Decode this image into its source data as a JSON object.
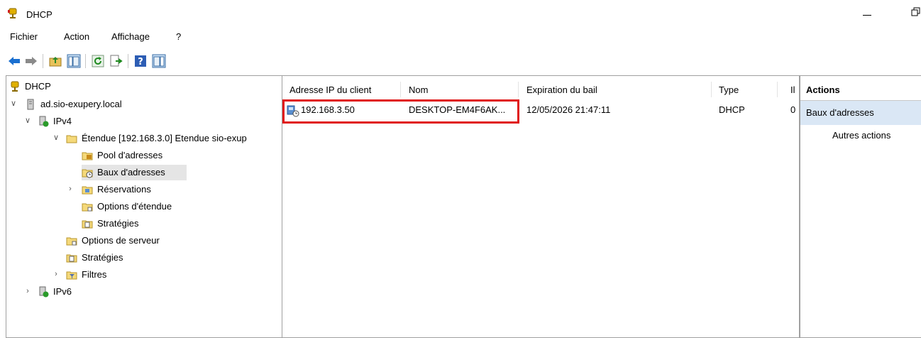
{
  "window": {
    "title": "DHCP"
  },
  "menu": [
    "Fichier",
    "Action",
    "Affichage",
    "?"
  ],
  "toolbar": {
    "buttons": [
      "back-icon",
      "forward-icon",
      "up-folder-icon",
      "show-hide-tree-icon",
      "refresh-icon",
      "export-list-icon",
      "help-icon",
      "show-hide-action-pane-icon"
    ]
  },
  "tree": {
    "root": "DHCP",
    "server": "ad.sio-exupery.local",
    "ipv4": "IPv4",
    "scope": "Étendue [192.168.3.0] Etendue sio-exup",
    "pool": "Pool d'adresses",
    "leases": "Baux d'adresses",
    "reservations": "Réservations",
    "scope_options": "Options d'étendue",
    "scope_policies": "Stratégies",
    "server_options": "Options de serveur",
    "policies": "Stratégies",
    "filters": "Filtres",
    "ipv6": "IPv6"
  },
  "table": {
    "headers": [
      "Adresse IP du client",
      "Nom",
      "Expiration du bail",
      "Type",
      "Il"
    ],
    "rows": [
      {
        "ip": "192.168.3.50",
        "name": "DESKTOP-EM4F6AK...",
        "expiration": "12/05/2026 21:47:11",
        "type": "DHCP",
        "extra": "0"
      }
    ]
  },
  "actions": {
    "header": "Actions",
    "section": "Baux d'adresses",
    "more": "Autres actions"
  },
  "colors": {
    "highlight": "#e01818",
    "selection": "#dae7f5"
  }
}
